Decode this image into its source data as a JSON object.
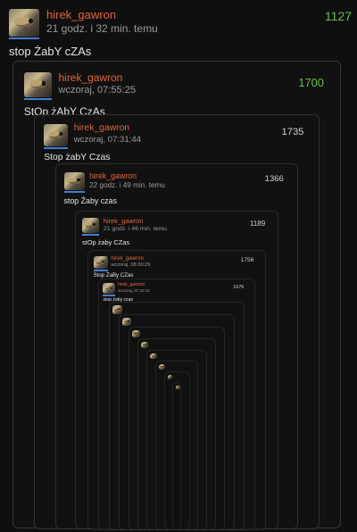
{
  "theme": {
    "background": "#0f0f0f",
    "author_color": "#e0643a",
    "vote_color_top": "#6cbf4a",
    "vote_color_nested": "#cfcfcf",
    "avatar_accent": "#3f7fd6"
  },
  "posts": [
    {
      "author": "hirek_gawron",
      "time": "21 godz. i 32 min. temu",
      "text": "stop ŻabY cZAs",
      "votes": "1127"
    },
    {
      "author": "hirek_gawron",
      "time": "wczoraj, 07:55:25",
      "text": "StOp żAbY CzAs",
      "votes": "1700"
    },
    {
      "author": "hirek_gawron",
      "time": "wczoraj, 07:31:44",
      "text": "Stop żabY Czas",
      "votes": "1735"
    },
    {
      "author": "hirek_gawron",
      "time": "22 godz. i 49 min. temu",
      "text": "stop Żaby czas",
      "votes": "1366"
    },
    {
      "author": "hirek_gawron",
      "time": "21 godz. i 46 min. temu",
      "text": "stOp żaby CZas",
      "votes": "1189"
    },
    {
      "author": "hirek_gawron",
      "time": "wczoraj, 08:30:29",
      "text": "Stop ŻaBy CZas",
      "votes": "1756"
    },
    {
      "author": "hirek_gawron",
      "time": "wczoraj, 07:42:11",
      "text": "stop żaby czas",
      "votes": "1676"
    }
  ],
  "icon": {
    "avatar": "frog-avatar-icon"
  }
}
